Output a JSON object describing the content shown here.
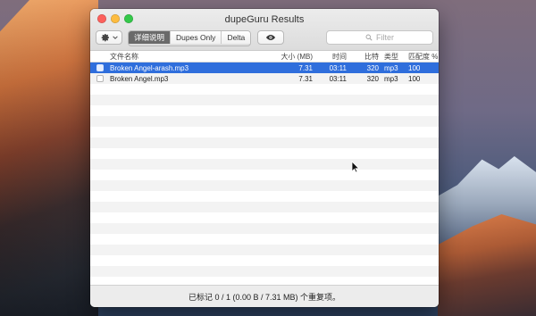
{
  "window": {
    "title": "dupeGuru Results"
  },
  "toolbar": {
    "segments": [
      {
        "label": "详细说明",
        "active": true
      },
      {
        "label": "Dupes Only",
        "active": false
      },
      {
        "label": "Delta",
        "active": false
      }
    ],
    "filter_placeholder": "Filter"
  },
  "table": {
    "columns": [
      "文件名称",
      "大小 (MB)",
      "时间",
      "比特",
      "类型",
      "匹配度 %"
    ],
    "rows": [
      {
        "name": "Broken Angel-arash.mp3",
        "size": "7.31",
        "time": "03:11",
        "bitrate": "320",
        "type": "mp3",
        "match": "100",
        "selected": true
      },
      {
        "name": "Broken Angel.mp3",
        "size": "7.31",
        "time": "03:11",
        "bitrate": "320",
        "type": "mp3",
        "match": "100",
        "selected": false
      }
    ]
  },
  "status": {
    "text": "已标记 0 / 1 (0.00 B / 7.31 MB) 个重复项。"
  },
  "icons": {
    "gear": "gear-icon",
    "chevron": "chevron-down-icon",
    "eye": "eye-icon",
    "search": "search-icon"
  }
}
